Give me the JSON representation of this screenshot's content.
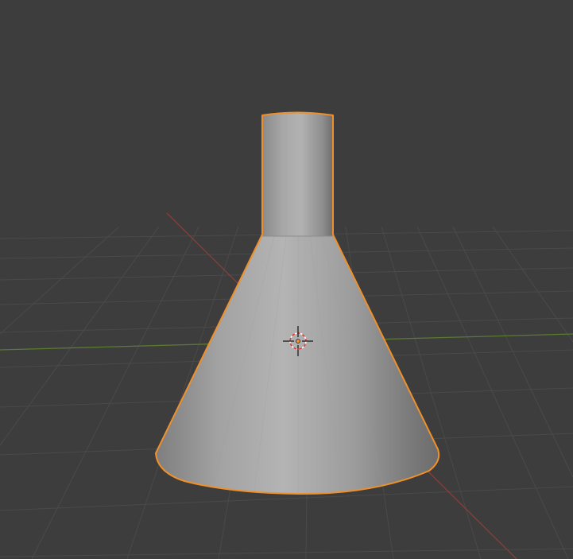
{
  "viewport": {
    "background_color": "#3d3d3d",
    "grid_color": "#4a4a4a",
    "x_axis_color": "#8a3d3d",
    "y_axis_color": "#5a7a32",
    "selection_outline_color": "#f0902a",
    "object_shading_color": "#a6a6a6"
  },
  "scene": {
    "selected_object": "flask-mesh",
    "cursor_icon": "3d-cursor-icon",
    "origin_icon": "object-origin-icon"
  }
}
